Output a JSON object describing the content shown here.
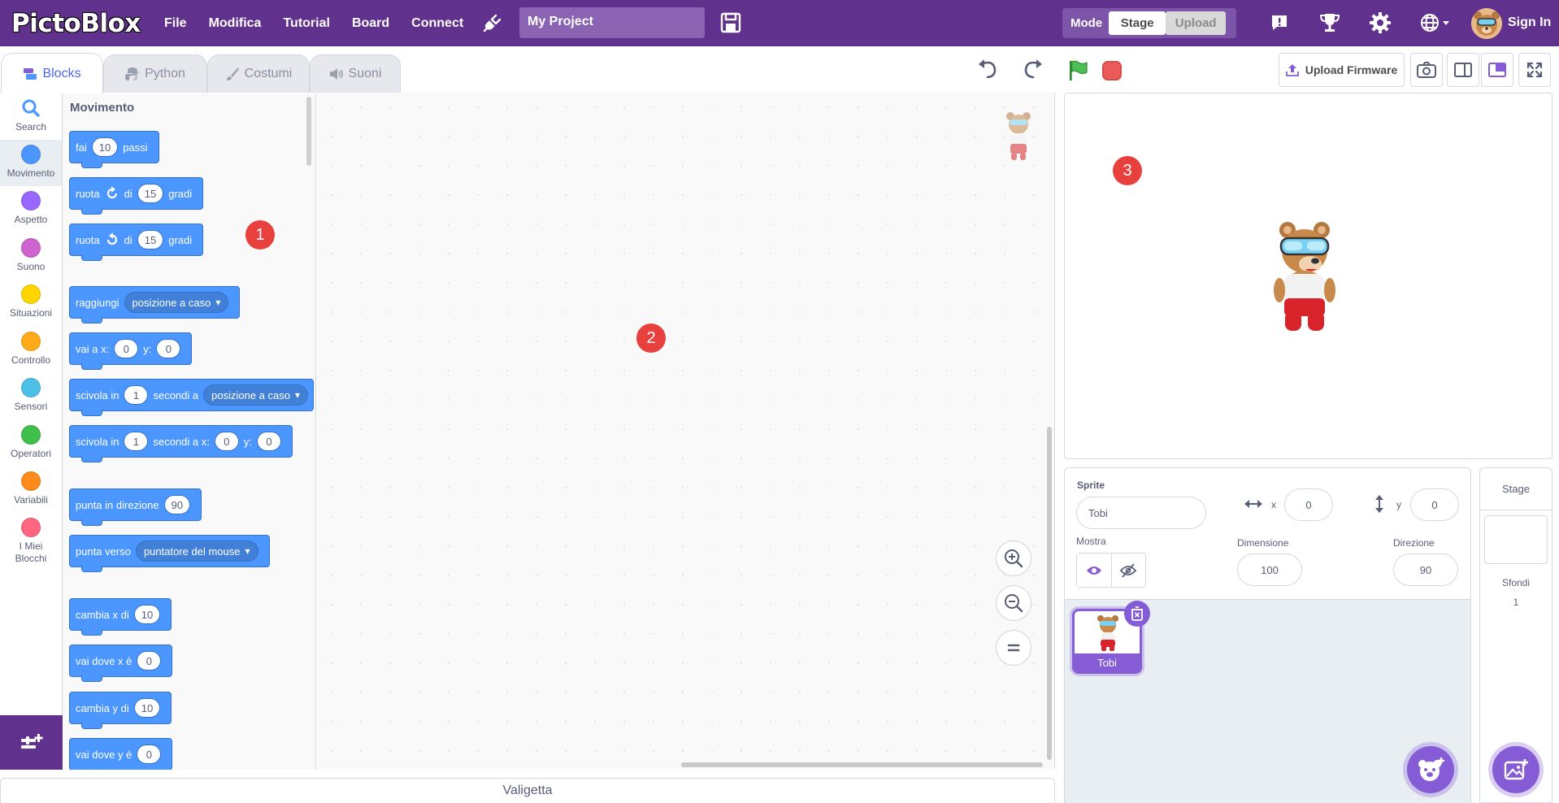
{
  "app": {
    "logo_text": "PictoBlox"
  },
  "menu": {
    "file": "File",
    "edit": "Modifica",
    "tutorial": "Tutorial",
    "board": "Board",
    "connect": "Connect"
  },
  "project": {
    "title": "My Project"
  },
  "mode": {
    "label": "Mode",
    "stage": "Stage",
    "upload": "Upload"
  },
  "account": {
    "sign_in": "Sign In"
  },
  "tabs": {
    "blocks": "Blocks",
    "python": "Python",
    "costumes": "Costumi",
    "sounds": "Suoni"
  },
  "toolbar": {
    "upload_firmware": "Upload Firmware"
  },
  "categories": [
    {
      "label": "Search"
    },
    {
      "label": "Movimento",
      "color": "#4c97ff"
    },
    {
      "label": "Aspetto",
      "color": "#9966ff"
    },
    {
      "label": "Suono",
      "color": "#cf63cf"
    },
    {
      "label": "Situazioni",
      "color": "#ffd500"
    },
    {
      "label": "Controllo",
      "color": "#ffab19"
    },
    {
      "label": "Sensori",
      "color": "#4cbfe6"
    },
    {
      "label": "Operatori",
      "color": "#40bf4a"
    },
    {
      "label": "Variabili",
      "color": "#ff8c1a"
    },
    {
      "label": "I Miei Blocchi",
      "color": "#ff6680"
    }
  ],
  "palette": {
    "title": "Movimento",
    "blocks": [
      {
        "p1": "fai",
        "v1": "10",
        "p2": "passi"
      },
      {
        "p1": "ruota",
        "p2": "di",
        "v1": "15",
        "p3": "gradi"
      },
      {
        "p1": "ruota",
        "p2": "di",
        "v1": "15",
        "p3": "gradi"
      },
      {
        "p1": "raggiungi",
        "d1": "posizione a caso"
      },
      {
        "p1": "vai a x:",
        "v1": "0",
        "p2": "y:",
        "v2": "0"
      },
      {
        "p1": "scivola in",
        "v1": "1",
        "p2": "secondi a",
        "d1": "posizione a caso"
      },
      {
        "p1": "scivola in",
        "v1": "1",
        "p2": "secondi a x:",
        "v2": "0",
        "p3": "y:",
        "v3": "0"
      },
      {
        "p1": "punta in direzione",
        "v1": "90"
      },
      {
        "p1": "punta verso",
        "d1": "puntatore del mouse"
      },
      {
        "p1": "cambia x di",
        "v1": "10"
      },
      {
        "p1": "vai dove x è",
        "v1": "0"
      },
      {
        "p1": "cambia y di",
        "v1": "10"
      },
      {
        "p1": "vai dove y è",
        "v1": "0"
      }
    ]
  },
  "markers": {
    "m1": "1",
    "m2": "2",
    "m3": "3"
  },
  "backpack": {
    "label": "Valigetta"
  },
  "sprite_info": {
    "sprite_label": "Sprite",
    "sprite_name": "Tobi",
    "x_label": "x",
    "x_value": "0",
    "y_label": "y",
    "y_value": "0",
    "show_label": "Mostra",
    "size_label": "Dimensione",
    "size_value": "100",
    "direction_label": "Direzione",
    "direction_value": "90"
  },
  "sprites": [
    {
      "name": "Tobi"
    }
  ],
  "stage_selector": {
    "title": "Stage",
    "backdrops_label": "Sfondi",
    "backdrops_count": "1"
  }
}
